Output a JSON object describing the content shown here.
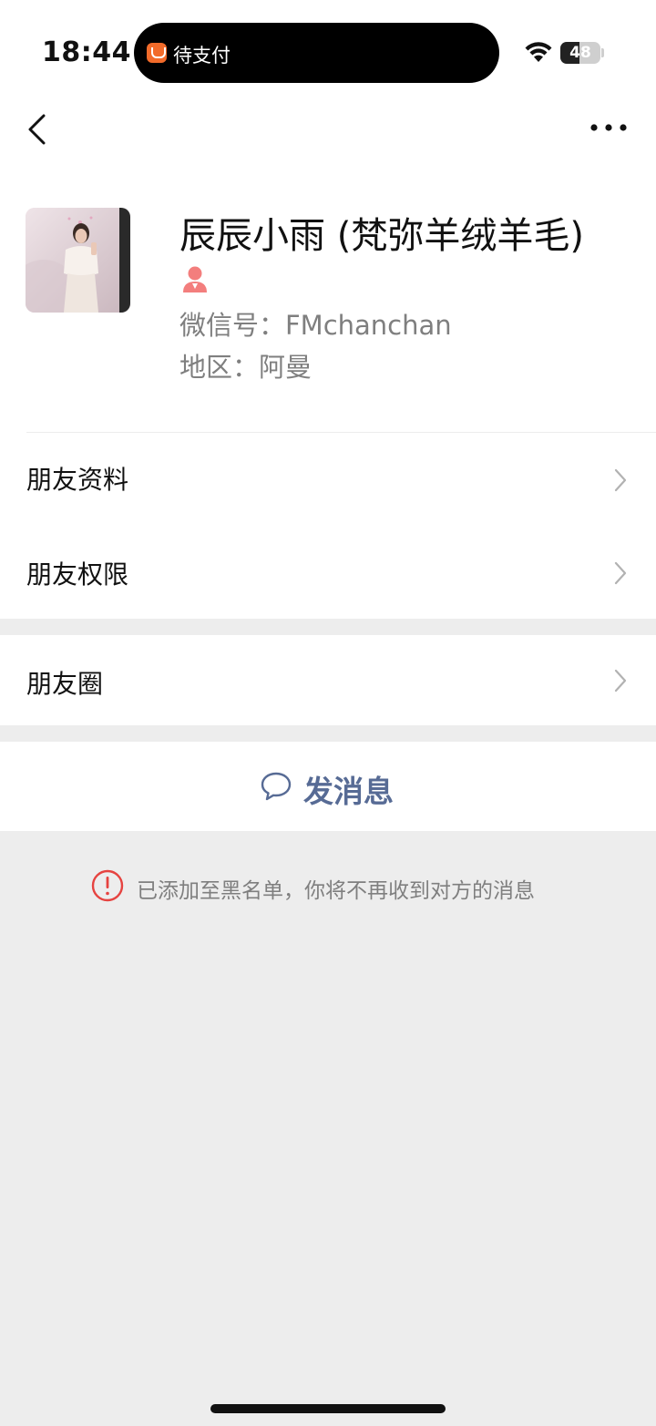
{
  "status_bar": {
    "time": "18:44",
    "island_text": "待支付",
    "battery": "48",
    "battery_level": 0.48
  },
  "nav": {
    "back_icon": "chevron-left-icon",
    "more_icon": "more-dots-icon"
  },
  "profile": {
    "name": "辰辰小雨 (梵弥羊绒羊毛)",
    "wechat_id": "微信号：FMchanchan",
    "region": "地区：阿曼",
    "gender_icon": "female-icon",
    "gender_color": "#f37e7d"
  },
  "menu": {
    "items": [
      {
        "label": "朋友资料"
      },
      {
        "label": "朋友权限"
      },
      {
        "label": "朋友圈"
      }
    ]
  },
  "message_button": {
    "label": "发消息",
    "icon": "chat-bubble-icon",
    "color": "#576b95"
  },
  "notice": {
    "text": "已添加至黑名单，你将不再收到对方的消息",
    "icon": "alert-circle-icon",
    "icon_color": "#e64340"
  }
}
